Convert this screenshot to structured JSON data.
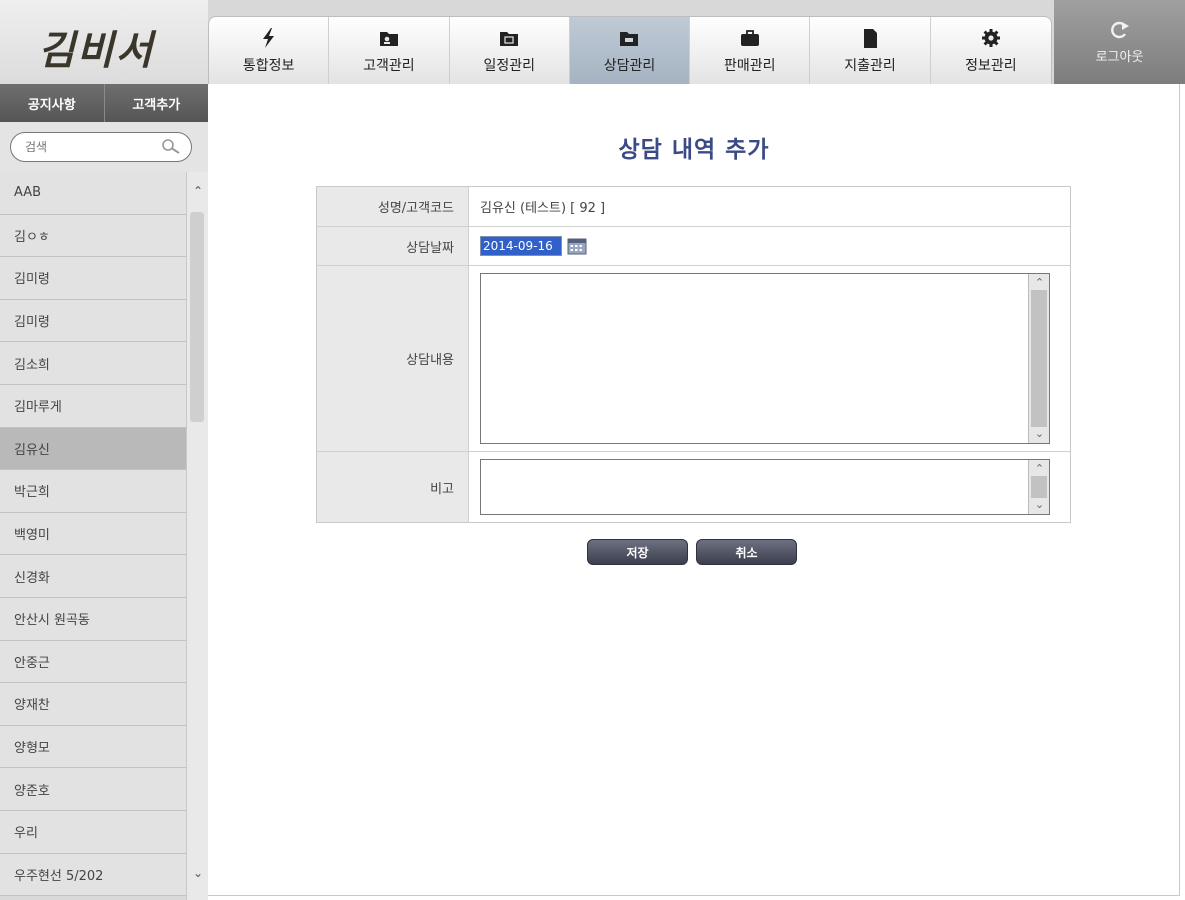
{
  "sidebar": {
    "logo": "김비서",
    "buttons": {
      "notice": "공지사항",
      "add_customer": "고객추가"
    },
    "search": {
      "placeholder": "검색"
    },
    "customers": [
      "AAB",
      "김ㅇㅎ",
      "김미령",
      "김미령",
      "김소희",
      "김마루게",
      "김유신",
      "박근희",
      "백영미",
      "신경화",
      "안산시 원곡동",
      "안중근",
      "양재찬",
      "양형모",
      "양준호",
      "우리",
      "우주현선 5/202"
    ],
    "selected_customer": "김유신"
  },
  "nav": {
    "tabs": [
      {
        "label": "통합정보",
        "icon": "lightning-icon"
      },
      {
        "label": "고객관리",
        "icon": "customer-folder-icon"
      },
      {
        "label": "일정관리",
        "icon": "schedule-folder-icon"
      },
      {
        "label": "상담관리",
        "icon": "consult-folder-icon",
        "active": true
      },
      {
        "label": "판매관리",
        "icon": "briefcase-icon"
      },
      {
        "label": "지출관리",
        "icon": "document-icon"
      },
      {
        "label": "정보관리",
        "icon": "gear-icon"
      }
    ],
    "logout": "로그아웃"
  },
  "main": {
    "title": "상담 내역 추가",
    "form": {
      "name_label": "성명/고객코드",
      "name_value": "김유신 (테스트)  [ 92 ]",
      "date_label": "상담날짜",
      "date_value": "2014-09-16",
      "content_label": "상담내용",
      "content_value": "",
      "note_label": "비고",
      "note_value": ""
    },
    "buttons": {
      "save": "저장",
      "cancel": "취소"
    }
  },
  "colors": {
    "title": "#3a4a86",
    "active_tab": "#b2bfcd",
    "button": "#4a4d5c",
    "sidebar": "#d9d9d9"
  }
}
